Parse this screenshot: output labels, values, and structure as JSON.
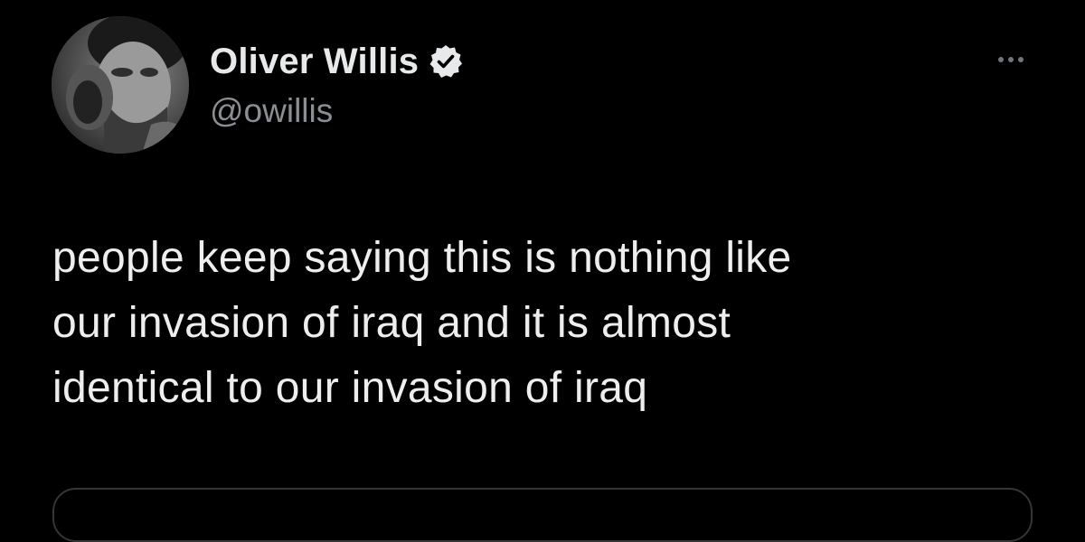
{
  "author": {
    "display_name": "Oliver Willis",
    "handle": "@owillis",
    "verified": true
  },
  "tweet": {
    "lines": [
      "people keep saying this is nothing like",
      "our invasion of iraq and it is almost",
      "identical to our invasion of iraq"
    ]
  },
  "icons": {
    "avatar": "profile-photo",
    "verified": "verified-badge-icon",
    "more": "more-options-icon"
  },
  "colors": {
    "background": "#000000",
    "text_primary": "#e7e9ea",
    "text_secondary": "#8b8f94",
    "border": "#333639"
  }
}
